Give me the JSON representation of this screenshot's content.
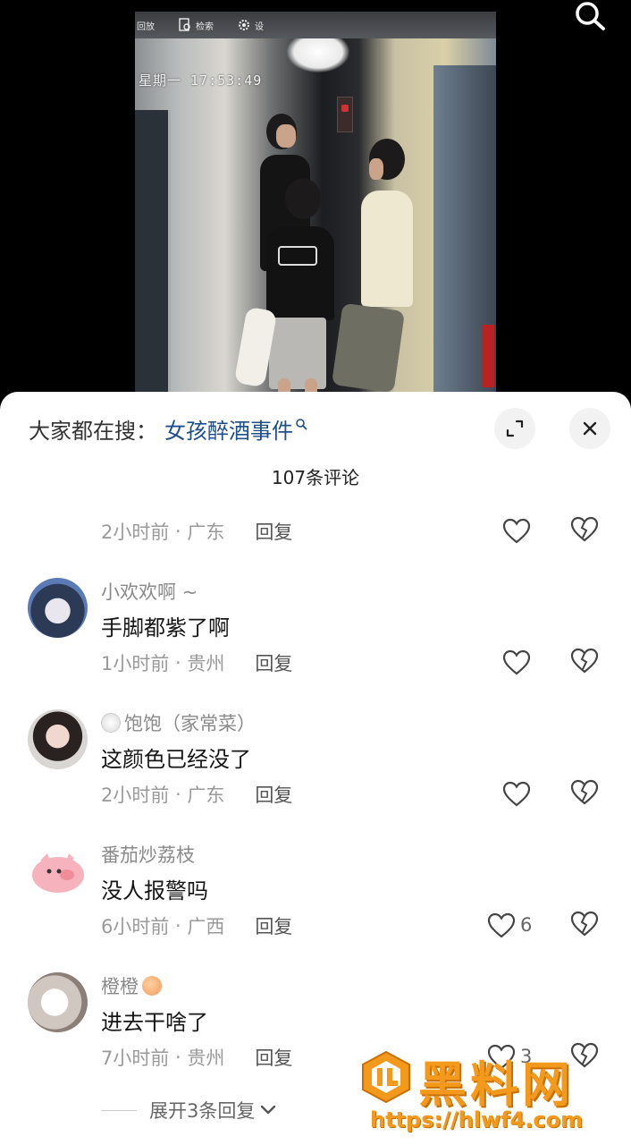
{
  "video": {
    "toolbar": {
      "playback_label": "回放",
      "search_label": "检索",
      "settings_label": "设"
    },
    "timestamp": "星期一 17:53:49"
  },
  "sheet": {
    "hot_search_prefix": "大家都在搜：",
    "hot_search_term": "女孩醉酒事件",
    "comment_count": "107条评论",
    "reply_label": "回复",
    "expand_replies": "展开3条回复"
  },
  "comments": [
    {
      "name": "",
      "text": "",
      "time": "2小时前",
      "location": "广东",
      "likes": ""
    },
    {
      "name": "小欢欢啊 ~",
      "text": "手脚都紫了啊",
      "time": "1小时前",
      "location": "贵州",
      "likes": ""
    },
    {
      "name": "饱饱（家常菜）",
      "text": "这颜色已经没了",
      "time": "2小时前",
      "location": "广东",
      "likes": ""
    },
    {
      "name": "番茄炒荔枝",
      "text": "没人报警吗",
      "time": "6小时前",
      "location": "广西",
      "likes": "6"
    },
    {
      "name": "橙橙",
      "text": "进去干啥了",
      "time": "7小时前",
      "location": "贵州",
      "likes": "3"
    }
  ],
  "watermark": {
    "title": "黑料网",
    "url": "https://hlwf4.com"
  },
  "colors": {
    "link_blue": "#1f4e8c",
    "watermark_orange": "#f39a1c"
  },
  "icons": [
    "search-icon",
    "expand-icon",
    "close-icon",
    "heart-icon",
    "broken-heart-icon",
    "chevron-down-icon"
  ]
}
